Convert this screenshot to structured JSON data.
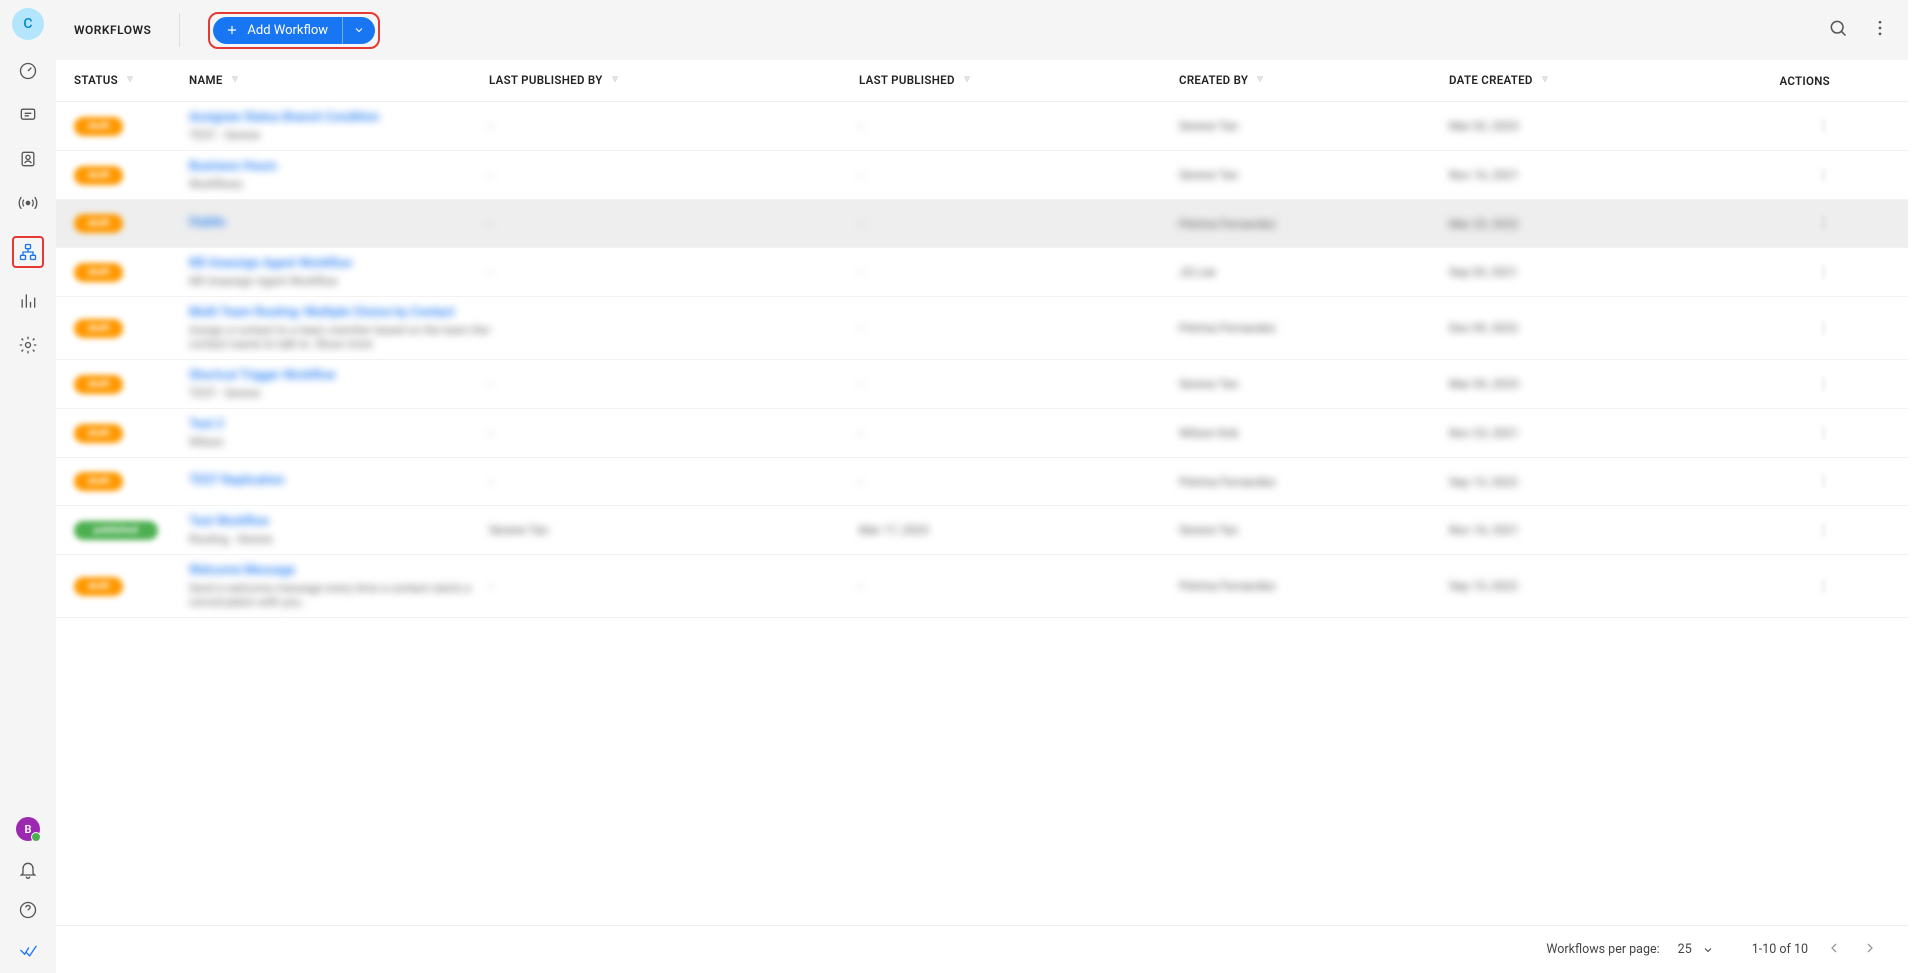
{
  "sidebar": {
    "workspace_letter": "C",
    "user_letter": "B"
  },
  "topbar": {
    "title": "WORKFLOWS",
    "add_label": "Add Workflow"
  },
  "columns": {
    "status": "STATUS",
    "name": "NAME",
    "last_published_by": "LAST PUBLISHED BY",
    "last_published": "LAST PUBLISHED",
    "created_by": "CREATED BY",
    "date_created": "DATE CREATED",
    "actions": "ACTIONS"
  },
  "rows": [
    {
      "status": "draft",
      "name": "Assignee Status Branch Condition",
      "desc": "TEST - Serene",
      "lpb": "-",
      "lp": "-",
      "cb": "Serene Tan",
      "dc": "Mar 02, 2023"
    },
    {
      "status": "draft",
      "name": "Business Hours",
      "desc": "Workflows",
      "lpb": "-",
      "lp": "-",
      "cb": "Serene Tan",
      "dc": "Nov 16, 2021"
    },
    {
      "status": "draft",
      "name": "Hubilo",
      "desc": "",
      "lpb": "-",
      "lp": "-",
      "cb": "Petrina Fernandez",
      "dc": "Mar 23, 2022",
      "highlight": true
    },
    {
      "status": "draft",
      "name": "KB Unassign Agent Workflow",
      "desc": "KB Unassign Agent Workflow",
      "lpb": "-",
      "lp": "-",
      "cb": "JQ Lee",
      "dc": "Sep 03, 2021"
    },
    {
      "status": "draft",
      "name": "Multi Team Routing: Multiple Choice by Contact",
      "desc": "Assign a contact to a team member based on the team the contact wants to talk to. Show more",
      "lpb": "-",
      "lp": "-",
      "cb": "Petrina Fernandez",
      "dc": "Dec 09, 2022"
    },
    {
      "status": "draft",
      "name": "Shortcut Trigger Workflow",
      "desc": "TEST - Serene",
      "lpb": "-",
      "lp": "-",
      "cb": "Serene Tan",
      "dc": "Mar 09, 2023"
    },
    {
      "status": "draft",
      "name": "Test 3",
      "desc": "Wilson",
      "lpb": "-",
      "lp": "-",
      "cb": "Wilson Kok",
      "dc": "Nov 23, 2021"
    },
    {
      "status": "draft",
      "name": "TEST Replication",
      "desc": "",
      "lpb": "-",
      "lp": "-",
      "cb": "Petrina Fernandez",
      "dc": "Sep 13, 2022"
    },
    {
      "status": "published",
      "name": "Test Workflow",
      "desc": "Routing - Serene",
      "lpb": "Serene Tan",
      "lp": "Mar 17, 2023",
      "cb": "Serene Tan",
      "dc": "Nov 16, 2021"
    },
    {
      "status": "draft",
      "name": "Welcome Message",
      "desc": "Send a welcome message every time a contact starts a conversation with you.",
      "lpb": "-",
      "lp": "-",
      "cb": "Petrina Fernandez",
      "dc": "Sep 15, 2022"
    }
  ],
  "pagination": {
    "label": "Workflows per page:",
    "per_page": "25",
    "range": "1-10 of 10"
  }
}
